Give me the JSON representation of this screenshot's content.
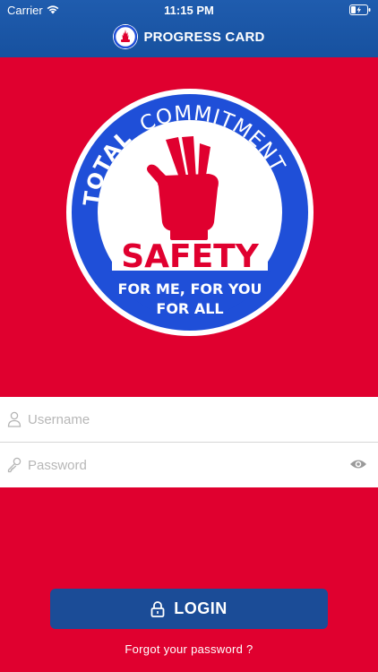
{
  "status_bar": {
    "carrier": "Carrier",
    "time": "11:15 PM"
  },
  "header": {
    "title": "PROGRESS CARD",
    "logo_icon": "raised-hand-logo-icon"
  },
  "badge": {
    "top_text_1": "TOTAL",
    "top_text_2": "COMMITMENT",
    "center_text": "SAFETY",
    "bottom_line_1": "FOR ME, FOR YOU",
    "bottom_line_2": "FOR ALL",
    "colors": {
      "blue": "#1f4fd8",
      "red": "#e0002f",
      "white": "#ffffff"
    }
  },
  "form": {
    "username_placeholder": "Username",
    "password_placeholder": "Password"
  },
  "actions": {
    "login_label": "LOGIN",
    "forgot_label": "Forgot your password ?"
  },
  "colors": {
    "background": "#e0002f",
    "header": "#1f5cae",
    "button": "#1b4c97"
  }
}
